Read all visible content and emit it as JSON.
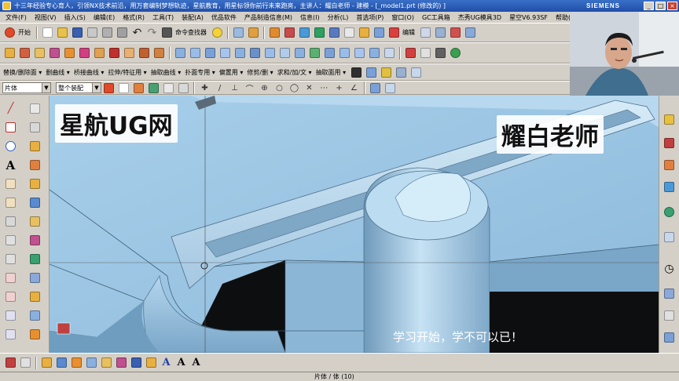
{
  "window": {
    "title": "十三年经验专心育人，引领NX技术前沿，用万套编制梦想轨迹，星航教育，用星标领你前行未来跑亮，主讲人：耀白老师 - 建模 - [_model1.prt (修改的) ]",
    "brand": "SIEMENS",
    "minimize": "_",
    "maximize": "□",
    "close": "×"
  },
  "menu": [
    "文件(F)",
    "视图(V)",
    "插入(S)",
    "编辑(E)",
    "格式(R)",
    "工具(T)",
    "装配(A)",
    "优品软件",
    "产品制造信息(M)",
    "信息(I)",
    "分析(L)",
    "首选项(P)",
    "窗口(O)",
    "GC工具箱",
    "杰秀UG模具3D",
    "星空V6.93SF",
    "帮助(H)"
  ],
  "toolbar1": {
    "start_label": "开始",
    "command_finder": "命令查找器",
    "edit_label": "编辑"
  },
  "toolbar3": {
    "labels": [
      "替换/删除面 ▾",
      "删曲线 ▾",
      "桥接曲线 ▾",
      "拉伸/特征用 ▾",
      "抽取曲线 ▾",
      "扑面专用 ▾",
      "偏置用 ▾",
      "修剪/删 ▾",
      "求和/加/文 ▾",
      "抽取面用 ▾"
    ]
  },
  "toolbar4": {
    "selection_filter": "片体",
    "assembly_scope": "整个装配"
  },
  "watermarks": {
    "left": "星航UG网",
    "right": "耀白老师"
  },
  "subtitle": "学习开始，学不可以已！",
  "status": {
    "text": "片体 / 体 (10)"
  },
  "colors": {
    "model": "#9ec9e6",
    "model_shadow": "#5f88a6",
    "viewport_bg": "#0d0e10",
    "titlebar": "#1f4fa8"
  }
}
